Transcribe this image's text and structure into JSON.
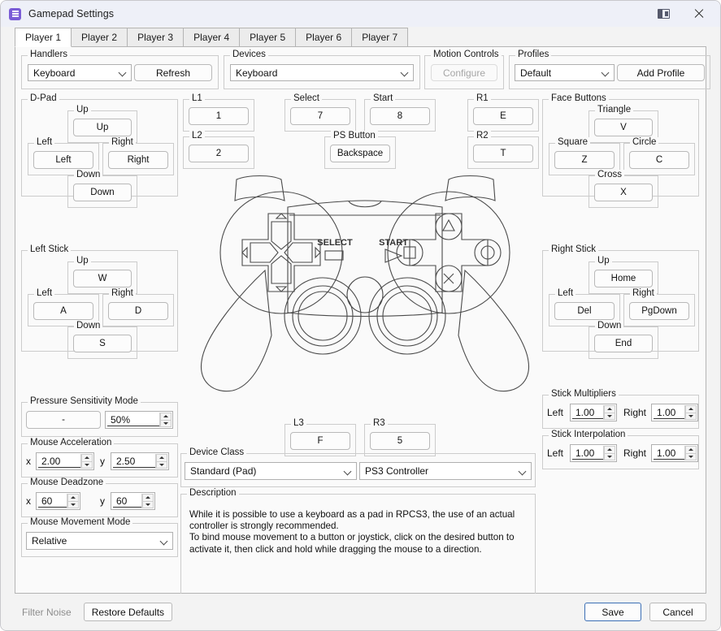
{
  "window": {
    "title": "Gamepad Settings",
    "app_icon": "list-icon",
    "panel_icon": "panel-toggle-icon",
    "close_icon": "close-icon"
  },
  "tabs": [
    {
      "label": "Player 1",
      "active": true
    },
    {
      "label": "Player 2",
      "active": false
    },
    {
      "label": "Player 3",
      "active": false
    },
    {
      "label": "Player 4",
      "active": false
    },
    {
      "label": "Player 5",
      "active": false
    },
    {
      "label": "Player 6",
      "active": false
    },
    {
      "label": "Player 7",
      "active": false
    }
  ],
  "handlers": {
    "title": "Handlers",
    "value": "Keyboard",
    "refresh_label": "Refresh"
  },
  "devices": {
    "title": "Devices",
    "value": "Keyboard"
  },
  "motion": {
    "title": "Motion Controls",
    "configure_label": "Configure",
    "configure_disabled": true
  },
  "profiles": {
    "title": "Profiles",
    "value": "Default",
    "add_label": "Add Profile"
  },
  "dpad": {
    "title": "D-Pad",
    "up_label": "Up",
    "up_value": "Up",
    "left_label": "Left",
    "left_value": "Left",
    "right_label": "Right",
    "right_value": "Right",
    "down_label": "Down",
    "down_value": "Down"
  },
  "left_stick": {
    "title": "Left Stick",
    "up_label": "Up",
    "up_value": "W",
    "left_label": "Left",
    "left_value": "A",
    "right_label": "Right",
    "right_value": "D",
    "down_label": "Down",
    "down_value": "S"
  },
  "face_buttons": {
    "title": "Face Buttons",
    "triangle_label": "Triangle",
    "triangle_value": "V",
    "square_label": "Square",
    "square_value": "Z",
    "circle_label": "Circle",
    "circle_value": "C",
    "cross_label": "Cross",
    "cross_value": "X"
  },
  "right_stick": {
    "title": "Right Stick",
    "up_label": "Up",
    "up_value": "Home",
    "left_label": "Left",
    "left_value": "Del",
    "right_label": "Right",
    "right_value": "PgDown",
    "down_label": "Down",
    "down_value": "End"
  },
  "shoulders": {
    "l1_label": "L1",
    "l1_value": "1",
    "l2_label": "L2",
    "l2_value": "2",
    "r1_label": "R1",
    "r1_value": "E",
    "r2_label": "R2",
    "r2_value": "T",
    "l3_label": "L3",
    "l3_value": "F",
    "r3_label": "R3",
    "r3_value": "5"
  },
  "system_buttons": {
    "select_label": "Select",
    "select_value": "7",
    "start_label": "Start",
    "start_value": "8",
    "ps_label": "PS Button",
    "ps_value": "Backspace"
  },
  "pressure": {
    "title": "Pressure Sensitivity Mode",
    "button_value": "-",
    "percent_value": "50%"
  },
  "mouse_acceleration": {
    "title": "Mouse Acceleration",
    "x_label": "x",
    "x_value": "2.00",
    "y_label": "y",
    "y_value": "2.50"
  },
  "mouse_deadzone": {
    "title": "Mouse Deadzone",
    "x_label": "x",
    "x_value": "60",
    "y_label": "y",
    "y_value": "60"
  },
  "mouse_movement": {
    "title": "Mouse Movement Mode",
    "value": "Relative"
  },
  "stick_multipliers": {
    "title": "Stick Multipliers",
    "left_label": "Left",
    "left_value": "1.00",
    "right_label": "Right",
    "right_value": "1.00"
  },
  "stick_interpolation": {
    "title": "Stick Interpolation",
    "left_label": "Left",
    "left_value": "1.00",
    "right_label": "Right",
    "right_value": "1.00"
  },
  "device_class": {
    "title": "Device Class",
    "class_value": "Standard (Pad)",
    "controller_value": "PS3 Controller"
  },
  "description": {
    "title": "Description",
    "text": "While it is possible to use a keyboard as a pad in RPCS3, the use of an actual controller is strongly recommended.\nTo bind mouse movement to a button or joystick, click on the desired button to activate it, then click and hold while dragging the mouse to a direction."
  },
  "gamepad_illustration": {
    "select_text": "SELECT",
    "start_text": "START"
  },
  "footer": {
    "filter_noise_label": "Filter Noise",
    "filter_noise_disabled": true,
    "restore_defaults_label": "Restore Defaults",
    "save_label": "Save",
    "cancel_label": "Cancel"
  }
}
